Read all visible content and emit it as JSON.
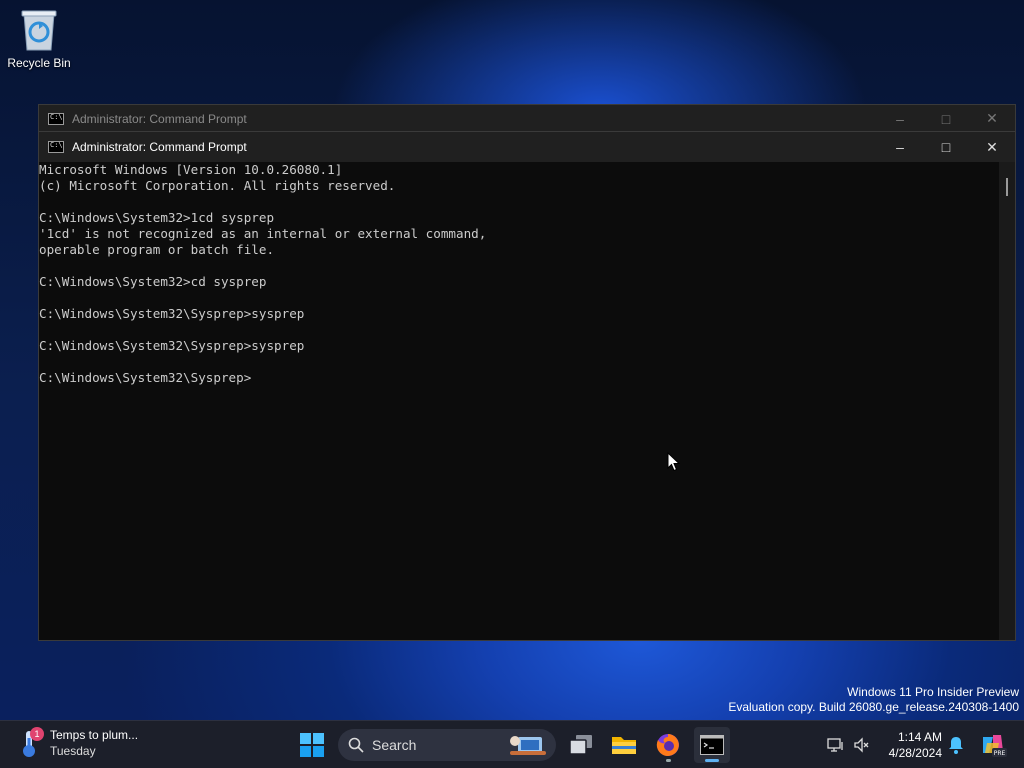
{
  "desktop": {
    "recycle_bin_label": "Recycle Bin"
  },
  "back_window": {
    "title": "Administrator: Command Prompt"
  },
  "front_window": {
    "title": "Administrator: Command Prompt",
    "console_text": "Microsoft Windows [Version 10.0.26080.1]\n(c) Microsoft Corporation. All rights reserved.\n\nC:\\Windows\\System32>1cd sysprep\n'1cd' is not recognized as an internal or external command,\noperable program or batch file.\n\nC:\\Windows\\System32>cd sysprep\n\nC:\\Windows\\System32\\Sysprep>sysprep\n\nC:\\Windows\\System32\\Sysprep>sysprep\n\nC:\\Windows\\System32\\Sysprep>"
  },
  "watermark": {
    "line1": "Windows 11 Pro Insider Preview",
    "line2": "Evaluation copy. Build 26080.ge_release.240308-1400"
  },
  "taskbar": {
    "weather_title": "Temps to plum...",
    "weather_sub": "Tuesday",
    "weather_badge": "1",
    "search_placeholder": "Search",
    "time": "1:14 AM",
    "date": "4/28/2024",
    "copilot_badge": "PRE"
  },
  "icons": {
    "recycle_bin": "recycle-bin-icon",
    "start": "windows-logo-icon",
    "task_view": "task-view-icon",
    "file_explorer": "folder-icon",
    "firefox": "firefox-icon",
    "terminal": "command-prompt-icon"
  },
  "colors": {
    "console_bg": "#0c0c0c",
    "console_fg": "#cccccc",
    "taskbar_bg": "#1c1f2a",
    "accent": "#5fb2f2"
  }
}
